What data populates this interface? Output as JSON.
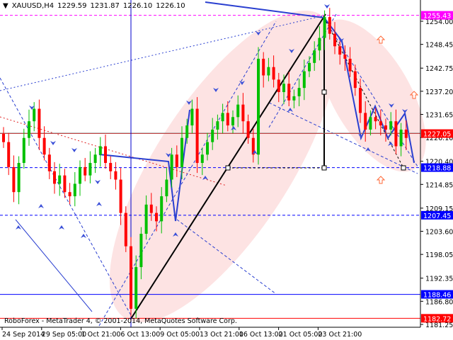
{
  "header": {
    "symbol": "XAUUSD,H4",
    "open": "1229.59",
    "high": "1231.87",
    "low": "1226.10",
    "close": "1226.10"
  },
  "copyright": "RoboForex - MetaTrader 4, © 2001-2014, MetaQuotes Software Corp.",
  "colors": {
    "bull": "#00c000",
    "bear": "#ff0000",
    "fractal": "#3a4fd8",
    "target_arrow": "#ff6a3a",
    "ellipse": "#fde3e3"
  },
  "chart_data": {
    "type": "candlestick",
    "title": "XAUUSD,H4",
    "ylim": [
      1181.25,
      1258.5
    ],
    "y_ticks": [
      "1254.00",
      "1248.45",
      "1242.75",
      "1237.20",
      "1231.65",
      "1226.10",
      "1220.40",
      "1214.85",
      "1209.15",
      "1203.60",
      "1198.05",
      "1192.35",
      "1186.80",
      "1181.25"
    ],
    "x_ticks": [
      "24 Sep 2014",
      "29 Sep 05:00",
      "1 Oct 21:00",
      "6 Oct 13:00",
      "9 Oct 05:00",
      "13 Oct 21:00",
      "16 Oct 13:00",
      "21 Oct 05:00",
      "23 Oct 21:00"
    ],
    "closes": [
      1225,
      1219,
      1213,
      1220,
      1226,
      1230,
      1233,
      1226,
      1222,
      1218,
      1215,
      1217,
      1213,
      1212,
      1215,
      1219,
      1217,
      1220,
      1222,
      1224,
      1220,
      1218,
      1216,
      1208,
      1200,
      1185,
      1195,
      1203,
      1210,
      1208,
      1206,
      1212,
      1216,
      1222,
      1219,
      1226,
      1229,
      1233,
      1220,
      1222,
      1225,
      1228,
      1230,
      1232,
      1229,
      1231,
      1234,
      1230,
      1226,
      1222,
      1245,
      1241,
      1243,
      1240,
      1237,
      1239,
      1235,
      1236,
      1238,
      1242,
      1244,
      1247,
      1250,
      1255,
      1251,
      1248,
      1246,
      1245,
      1242,
      1238,
      1232,
      1228,
      1231,
      1230,
      1229,
      1228,
      1230,
      1224,
      1228,
      1226
    ],
    "levels": [
      {
        "price": "1255.43",
        "color": "#ff00ff",
        "style": "dashed"
      },
      {
        "price": "1227.05",
        "color": "#ff0000",
        "style": "solid"
      },
      {
        "price": "1218.88",
        "color": "#0000ff",
        "style": "dashed"
      },
      {
        "price": "1207.45",
        "color": "#0000ff",
        "style": "dashed"
      },
      {
        "price": "1188.46",
        "color": "#0000ff",
        "style": "solid"
      },
      {
        "price": "1182.72",
        "color": "#ff0000",
        "style": "solid"
      }
    ]
  }
}
